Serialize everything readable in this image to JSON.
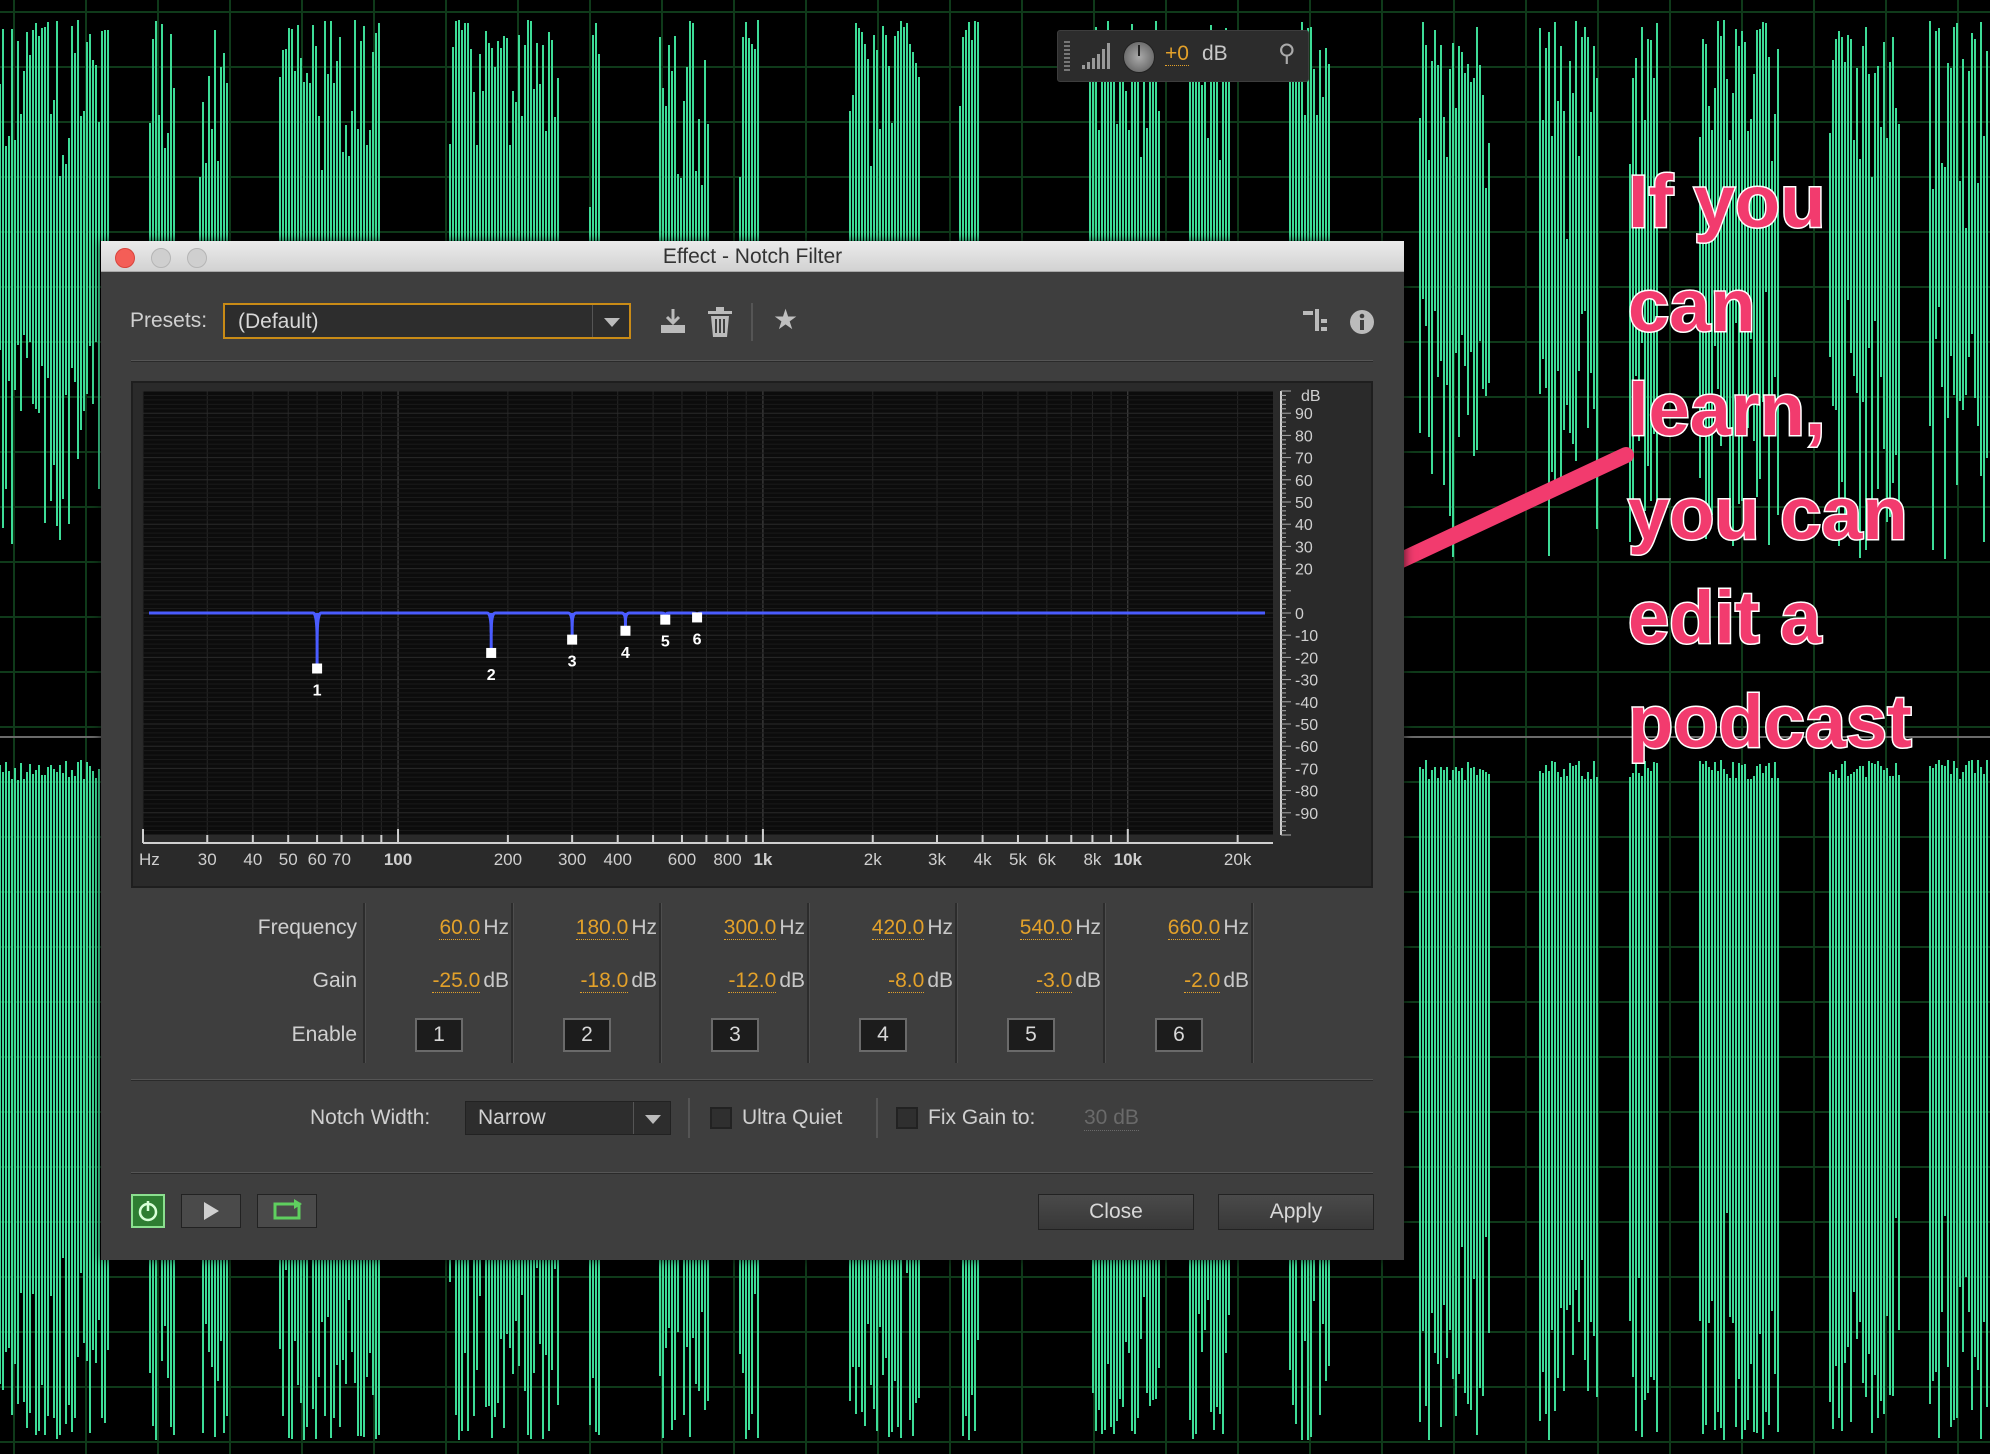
{
  "hud": {
    "value": "+0",
    "unit": "dB"
  },
  "dialog": {
    "title": "Effect - Notch Filter",
    "presets_label": "Presets:",
    "preset_value": "(Default)",
    "graph": {
      "x_ticks": [
        "Hz",
        "30",
        "40",
        "50",
        "60",
        "70",
        "100",
        "200",
        "300",
        "400",
        "600",
        "800",
        "1k",
        "2k",
        "3k",
        "4k",
        "5k",
        "6k",
        "8k",
        "10k",
        "20k"
      ],
      "y_unit": "dB",
      "y_ticks": [
        "90",
        "80",
        "70",
        "60",
        "50",
        "40",
        "30",
        "20",
        "0",
        "-10",
        "-20",
        "-30",
        "-40",
        "-50",
        "-60",
        "-70",
        "-80",
        "-90"
      ],
      "notch_labels": [
        "1",
        "2",
        "3",
        "4",
        "5",
        "6"
      ]
    },
    "row_labels": {
      "frequency": "Frequency",
      "gain": "Gain",
      "enable": "Enable"
    },
    "units": {
      "hz": "Hz",
      "db": "dB"
    },
    "bands": [
      {
        "freq": "60.0",
        "gain": "-25.0",
        "enable": "1"
      },
      {
        "freq": "180.0",
        "gain": "-18.0",
        "enable": "2"
      },
      {
        "freq": "300.0",
        "gain": "-12.0",
        "enable": "3"
      },
      {
        "freq": "420.0",
        "gain": "-8.0",
        "enable": "4"
      },
      {
        "freq": "540.0",
        "gain": "-3.0",
        "enable": "5"
      },
      {
        "freq": "660.0",
        "gain": "-2.0",
        "enable": "6"
      }
    ],
    "notch_width_label": "Notch Width:",
    "notch_width_value": "Narrow",
    "ultra_quiet_label": "Ultra Quiet",
    "fix_gain_label": "Fix Gain to:",
    "fix_gain_value": "30 dB",
    "close_label": "Close",
    "apply_label": "Apply"
  },
  "annotation": {
    "text": "If you\ncan\nlearn,\nyou can\nedit a\npodcast"
  },
  "colors": {
    "waveform": "#3ddc97",
    "curve": "#4a5cff",
    "accent": "#e3a12a",
    "annotation": "#f23b6e"
  }
}
